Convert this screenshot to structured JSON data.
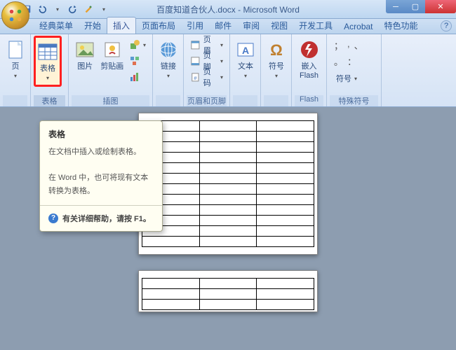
{
  "title": "百度知道合伙人.docx - Microsoft Word",
  "tabs": [
    "经典菜单",
    "开始",
    "插入",
    "页面布局",
    "引用",
    "邮件",
    "审阅",
    "视图",
    "开发工具",
    "Acrobat",
    "特色功能"
  ],
  "active_tab_index": 2,
  "ribbon": {
    "page": {
      "label": "页",
      "group": ""
    },
    "table": {
      "label": "表格",
      "group": "表格"
    },
    "picture": "图片",
    "clipart": "剪贴画",
    "illus_group": "插图",
    "link": "链接",
    "header": "页眉",
    "footer": "页脚",
    "pagenum": "页码",
    "hf_group": "页眉和页脚",
    "textbox": "文本",
    "symbol": "符号",
    "flash": "嵌入\nFlash",
    "flash_group": "Flash",
    "symlabel": "符号",
    "sym_group": "特殊符号",
    "syms": [
      ",",
      "。",
      "；",
      "、",
      "："
    ]
  },
  "tooltip": {
    "title": "表格",
    "line1": "在文档中插入或绘制表格。",
    "line2": "在 Word 中，也可将现有文本转换为表格。",
    "help": "有关详细帮助，请按 F1。"
  },
  "doc": {
    "cols": 3,
    "rows_page1": 12,
    "rows_page2": 3
  }
}
